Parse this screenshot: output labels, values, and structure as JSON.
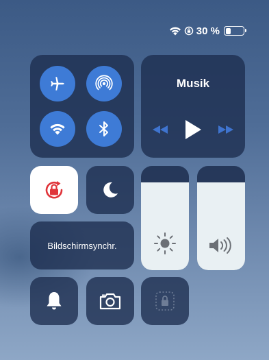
{
  "status": {
    "battery_percent": "30 %",
    "battery_level": 0.3,
    "icons": [
      "wifi-icon",
      "rotation-lock-status-icon",
      "battery-icon"
    ]
  },
  "connectivity": {
    "buttons": [
      {
        "name": "airplane-mode",
        "icon": "airplane-icon",
        "active": true
      },
      {
        "name": "airdrop",
        "icon": "airdrop-icon",
        "active": true
      },
      {
        "name": "wifi",
        "icon": "wifi-icon",
        "active": true
      },
      {
        "name": "bluetooth",
        "icon": "bluetooth-icon",
        "active": true
      }
    ]
  },
  "media": {
    "title": "Musik",
    "controls": [
      "rewind-icon",
      "play-icon",
      "fast-forward-icon"
    ]
  },
  "tiles": {
    "rotation_lock": {
      "icon": "rotation-lock-icon",
      "active": true
    },
    "do_not_disturb": {
      "icon": "moon-icon",
      "active": false
    },
    "screen_mirroring": {
      "label": "Bildschirmsynchr."
    },
    "bell": {
      "icon": "bell-icon"
    },
    "camera": {
      "icon": "camera-icon"
    },
    "guided_access": {
      "icon": "lock-dotted-icon"
    }
  },
  "sliders": {
    "brightness": {
      "icon": "sun-icon",
      "level": 0.84
    },
    "volume": {
      "icon": "speaker-icon",
      "level": 0.84
    }
  },
  "colors": {
    "accent_blue": "#3e7bd6",
    "rotation_lock_red": "#e0343a",
    "module_bg": "#1c2d4e",
    "slider_fill": "#e9f0f3",
    "media_dim_blue": "#3f74cf"
  }
}
